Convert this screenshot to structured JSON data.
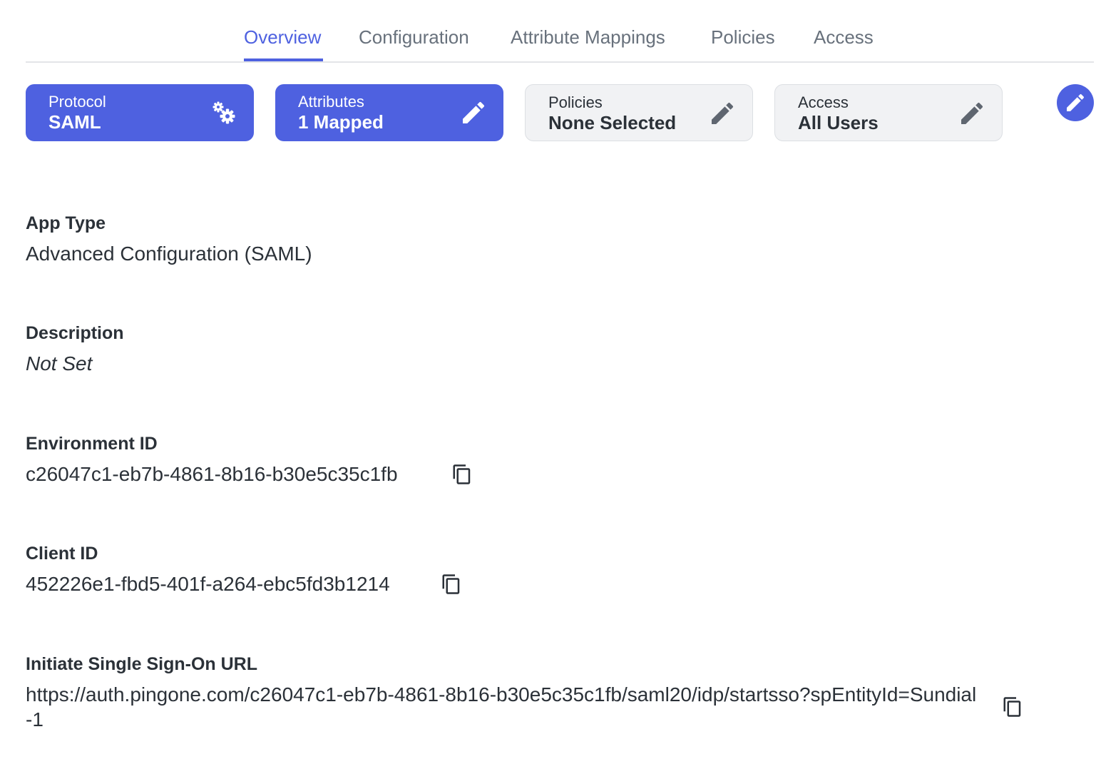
{
  "tabs": [
    {
      "label": "Overview",
      "active": true
    },
    {
      "label": "Configuration",
      "active": false
    },
    {
      "label": "Attribute Mappings",
      "active": false
    },
    {
      "label": "Policies",
      "active": false
    },
    {
      "label": "Access",
      "active": false
    }
  ],
  "cards": {
    "protocol": {
      "label": "Protocol",
      "value": "SAML",
      "icon": "gears-icon"
    },
    "attributes": {
      "label": "Attributes",
      "value": "1 Mapped",
      "icon": "pencil-icon"
    },
    "policies": {
      "label": "Policies",
      "value": "None Selected",
      "icon": "pencil-icon"
    },
    "access": {
      "label": "Access",
      "value": "All Users",
      "icon": "pencil-icon"
    }
  },
  "fields": {
    "app_type": {
      "label": "App Type",
      "value": "Advanced Configuration (SAML)"
    },
    "description": {
      "label": "Description",
      "value": "Not Set"
    },
    "environment_id": {
      "label": "Environment ID",
      "value": "c26047c1-eb7b-4861-8b16-b30e5c35c1fb"
    },
    "client_id": {
      "label": "Client ID",
      "value": "452226e1-fbd5-401f-a264-ebc5fd3b1214"
    },
    "sso_url": {
      "label": "Initiate Single Sign-On URL",
      "value": "https://auth.pingone.com/c26047c1-eb7b-4861-8b16-b30e5c35c1fb/saml20/idp/startsso?spEntityId=Sundial-1"
    }
  },
  "colors": {
    "accent": "#4e61e0",
    "text": "#2b3138",
    "muted_tab": "#68717c",
    "card_gray": "#f1f2f4",
    "icon_gray": "#5f6670"
  }
}
